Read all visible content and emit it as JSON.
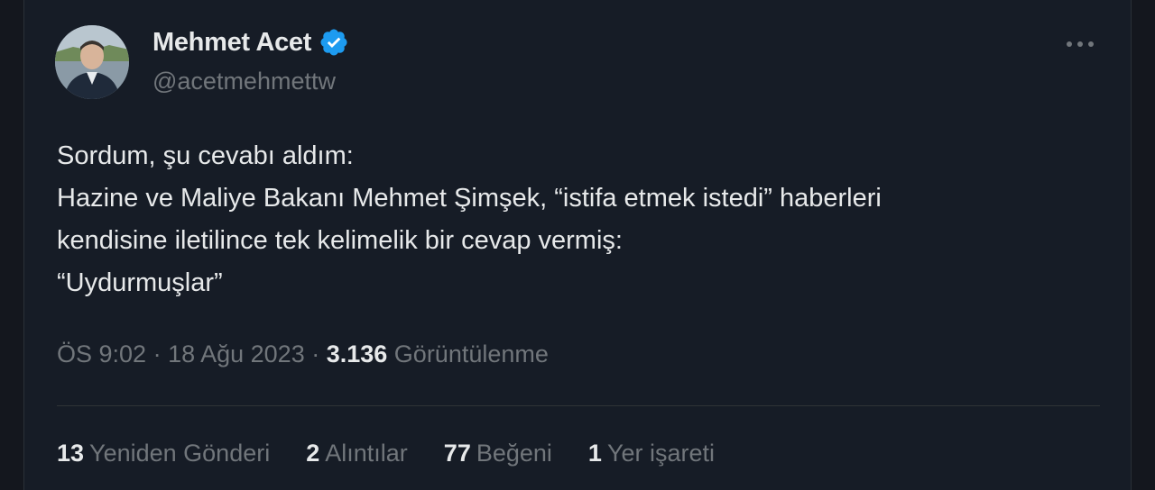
{
  "author": {
    "name": "Mehmet Acet",
    "handle": "@acetmehmettw",
    "verified_color": "#1d9bf0"
  },
  "tweet": {
    "lines": [
      "Sordum, şu cevabı aldım:",
      "Hazine ve Maliye Bakanı Mehmet Şimşek, “istifa etmek istedi” haberleri",
      "kendisine iletilince tek kelimelik bir cevap vermiş:",
      "“Uydurmuşlar”"
    ]
  },
  "meta": {
    "time": "ÖS 9:02",
    "sep1": " · ",
    "date": "18 Ağu 2023",
    "sep2": " · ",
    "views_count": "3.136",
    "views_label": " Görüntülenme"
  },
  "stats": [
    {
      "count": "13",
      "label": "Yeniden Gönderi"
    },
    {
      "count": "2",
      "label": "Alıntılar"
    },
    {
      "count": "77",
      "label": "Beğeni"
    },
    {
      "count": "1",
      "label": "Yer işareti"
    }
  ],
  "icons": {
    "more": "more-icon",
    "verified": "verified-badge-icon"
  },
  "colors": {
    "background": "#161c26",
    "text": "#e7e9ea",
    "secondary": "#71767b",
    "accent": "#1d9bf0"
  }
}
